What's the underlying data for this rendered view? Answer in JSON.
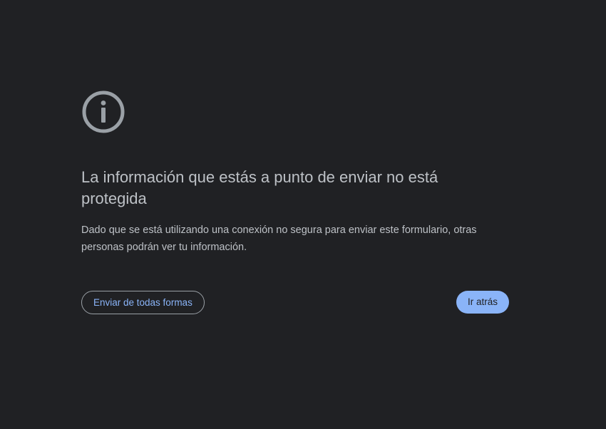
{
  "page": {
    "icon": "info-icon",
    "heading": "La información que estás a punto de enviar no está protegida",
    "description": "Dado que se está utilizando una conexión no segura para enviar este formulario, otras personas podrán ver tu información."
  },
  "actions": {
    "send_anyway_label": "Enviar de todas formas",
    "go_back_label": "Ir atrás"
  },
  "colors": {
    "background": "#202124",
    "text": "#bdc1c6",
    "accent": "#8ab4f8"
  }
}
